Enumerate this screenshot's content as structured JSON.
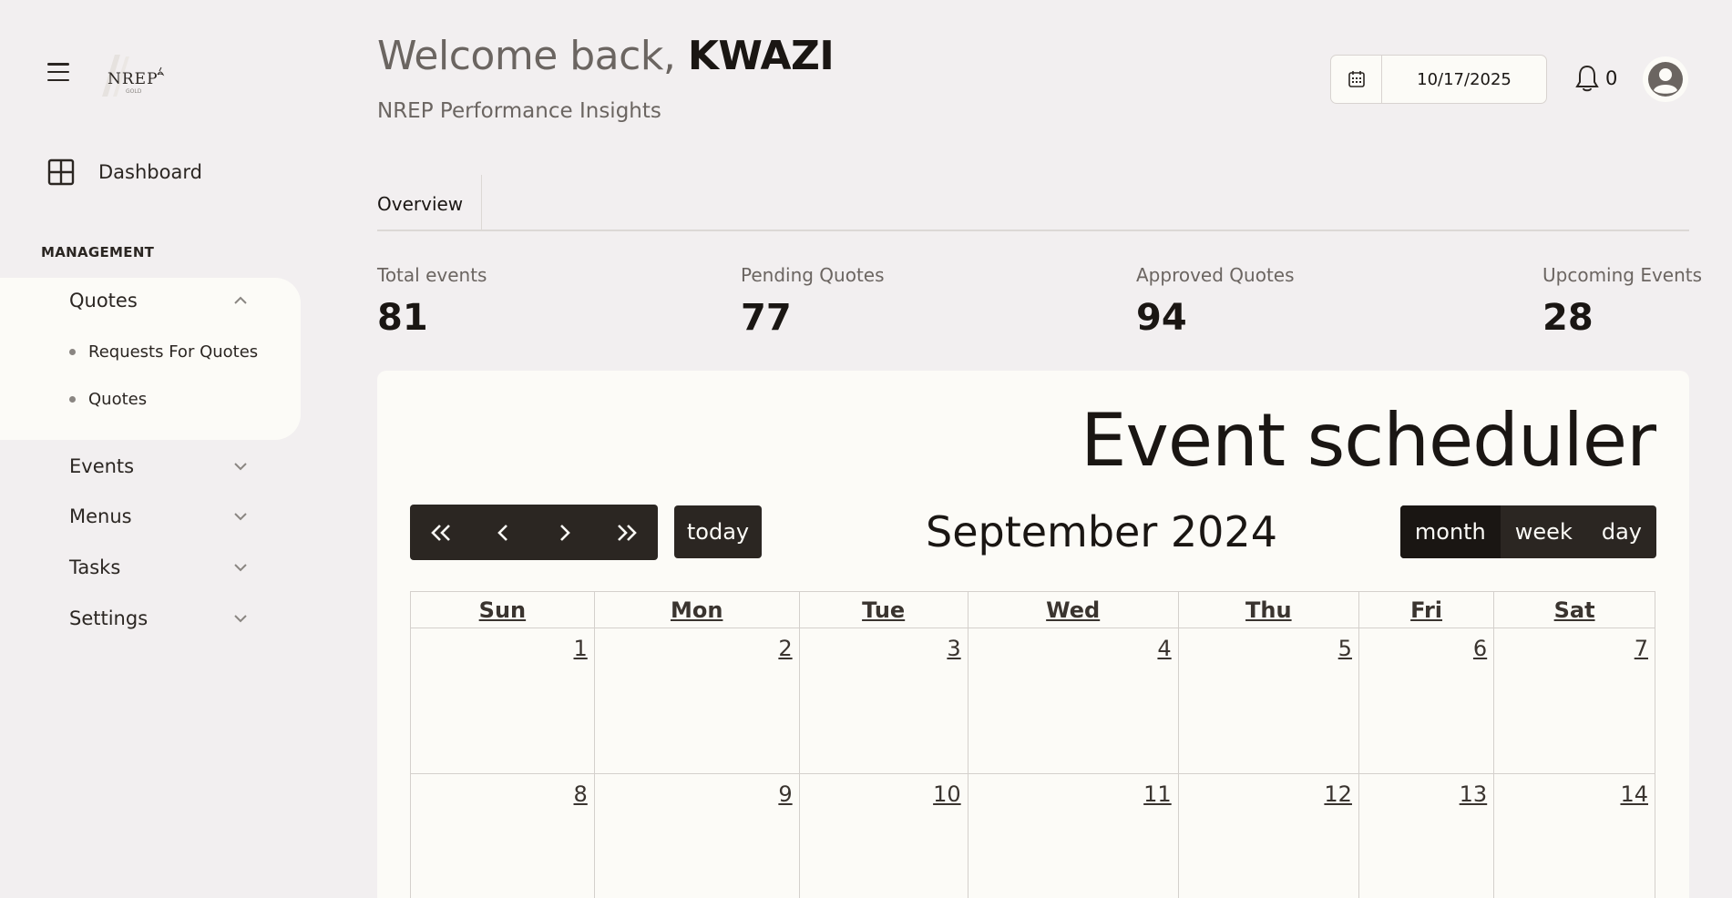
{
  "sidebar": {
    "logo_text": "NREP",
    "dashboard_label": "Dashboard",
    "section_title": "MANAGEMENT",
    "quotes": {
      "label": "Quotes",
      "subitems": [
        "Requests For Quotes",
        "Quotes"
      ]
    },
    "items": [
      {
        "label": "Events"
      },
      {
        "label": "Menus"
      },
      {
        "label": "Tasks"
      },
      {
        "label": "Settings"
      }
    ]
  },
  "header": {
    "welcome_prefix": "Welcome back,",
    "user_name": "KWAZI",
    "subtitle": "NREP Performance Insights",
    "date_value": "10/17/2025",
    "notification_count": "0"
  },
  "tabs": [
    {
      "label": "Overview"
    }
  ],
  "stats": [
    {
      "label": "Total events",
      "value": "81"
    },
    {
      "label": "Pending Quotes",
      "value": "77"
    },
    {
      "label": "Approved Quotes",
      "value": "94"
    },
    {
      "label": "Upcoming Events",
      "value": "28"
    }
  ],
  "scheduler": {
    "title": "Event scheduler",
    "today_label": "today",
    "month_title": "September 2024",
    "views": [
      "month",
      "week",
      "day"
    ],
    "active_view": "month",
    "days": [
      "Sun",
      "Mon",
      "Tue",
      "Wed",
      "Thu",
      "Fri",
      "Sat"
    ],
    "weeks": [
      [
        "1",
        "2",
        "3",
        "4",
        "5",
        "6",
        "7"
      ],
      [
        "8",
        "9",
        "10",
        "11",
        "12",
        "13",
        "14"
      ]
    ]
  },
  "colors": {
    "background": "#f2eff0",
    "card": "#fcfbf7",
    "dark_button": "#2b2622",
    "text_dark": "#1a1613",
    "text_muted": "#6b6561"
  }
}
